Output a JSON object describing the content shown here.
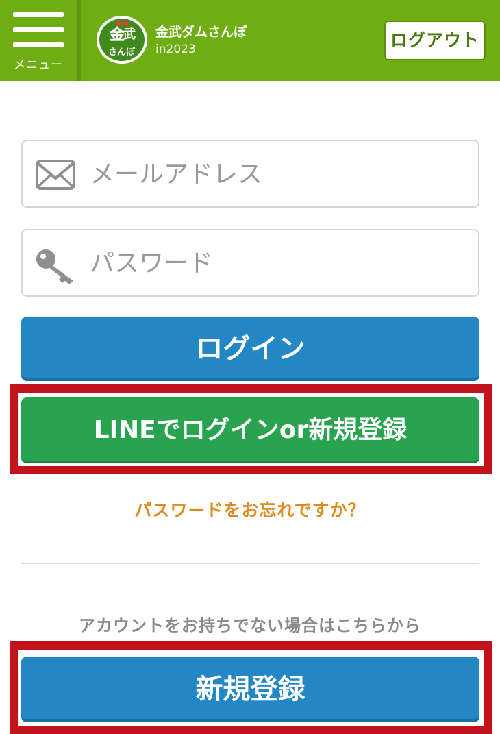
{
  "header": {
    "menu_label": "メニュー",
    "app_title": "金武ダムさんぽ",
    "app_subtitle": "in2023",
    "logo_text": "金武ダムさんぽ",
    "logout_label": "ログアウト",
    "bg_color": "#6fae13"
  },
  "login_form": {
    "email_placeholder": "メールアドレス",
    "email_value": "",
    "password_placeholder": "パスワード",
    "password_value": "",
    "login_label": "ログイン",
    "line_login_label": "LINEでログインor新規登録",
    "forgot_password_label": "パスワードをお忘れですか？"
  },
  "signup": {
    "prompt": "アカウントをお持ちでない場合はこちらから",
    "register_label": "新規登録"
  },
  "icons": {
    "menu": "hamburger-icon",
    "email": "envelope-icon",
    "password": "key-icon"
  },
  "colors": {
    "primary_blue": "#2387c6",
    "line_green": "#29a34f",
    "highlight_red": "#c1131b",
    "link_orange": "#e08a1e"
  }
}
